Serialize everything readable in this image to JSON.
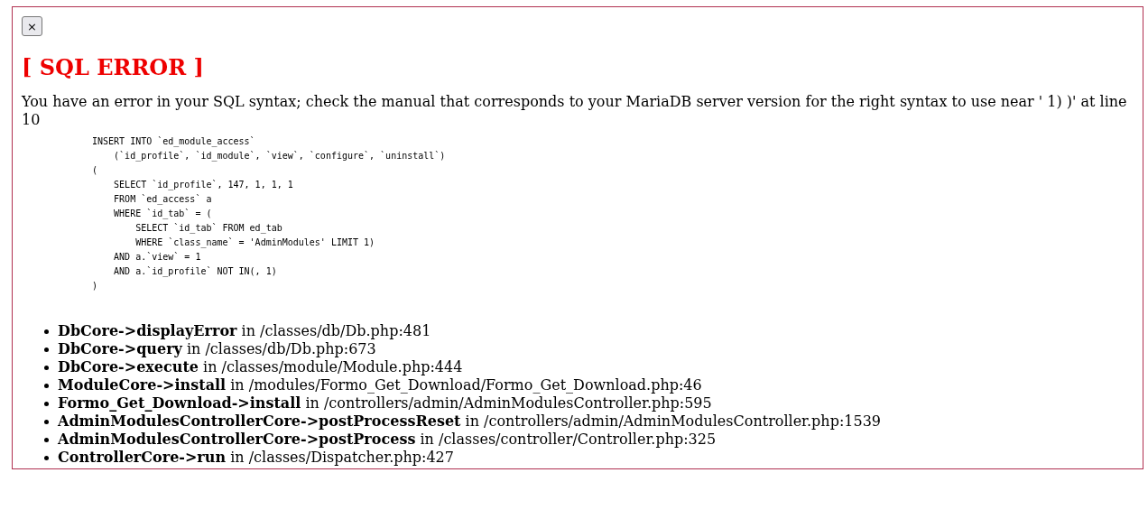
{
  "close_button": {
    "label": "×"
  },
  "title": "[ SQL ERROR ]",
  "message": "You have an error in your SQL syntax; check the manual that corresponds to your MariaDB server version for the right syntax to use near ' 1) )' at line 10",
  "query": "INSERT INTO `ed_module_access`\n    (`id_profile`, `id_module`, `view`, `configure`, `uninstall`)\n(\n    SELECT `id_profile`, 147, 1, 1, 1\n    FROM `ed_access` a\n    WHERE `id_tab` = (\n        SELECT `id_tab` FROM ed_tab\n        WHERE `class_name` = 'AdminModules' LIMIT 1)\n    AND a.`view` = 1\n    AND a.`id_profile` NOT IN(, 1)\n)",
  "stack_trace": [
    {
      "call": "DbCore->displayError",
      "location": "in /classes/db/Db.php:481"
    },
    {
      "call": "DbCore->query",
      "location": "in /classes/db/Db.php:673"
    },
    {
      "call": "DbCore->execute",
      "location": "in /classes/module/Module.php:444"
    },
    {
      "call": "ModuleCore->install",
      "location": "in /modules/Formo_Get_Download/Formo_Get_Download.php:46"
    },
    {
      "call": "Formo_Get_Download->install",
      "location": "in /controllers/admin/AdminModulesController.php:595"
    },
    {
      "call": "AdminModulesControllerCore->postProcessReset",
      "location": "in /controllers/admin/AdminModulesController.php:1539"
    },
    {
      "call": "AdminModulesControllerCore->postProcess",
      "location": "in /classes/controller/Controller.php:325"
    },
    {
      "call": "ControllerCore->run",
      "location": "in /classes/Dispatcher.php:427"
    }
  ]
}
